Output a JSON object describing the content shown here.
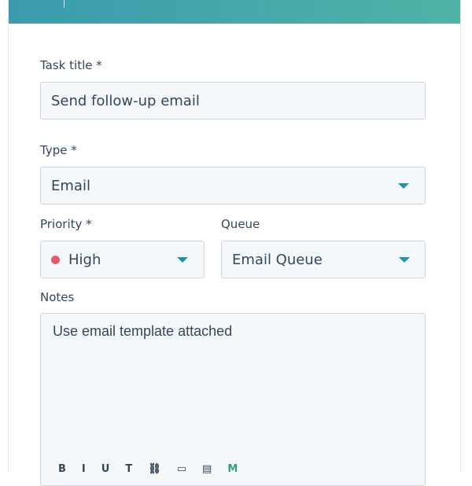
{
  "form": {
    "task_title": {
      "label": "Task title *",
      "value": "Send follow-up email"
    },
    "type": {
      "label": "Type *",
      "value": "Email"
    },
    "priority": {
      "label": "Priority *",
      "value": "High",
      "color": "#e35a6a"
    },
    "queue": {
      "label": "Queue",
      "value": "Email Queue"
    },
    "notes": {
      "label": "Notes",
      "value": "Use email template attached"
    }
  },
  "toolbar": {
    "items": [
      "B",
      "I",
      "U",
      "T",
      "link-icon",
      "image-icon",
      "document-icon",
      "M"
    ]
  },
  "colors": {
    "header_start": "#3a9cae",
    "header_end": "#4fb3a6",
    "caret": "#1f91ae",
    "field_background": "#f5f8fa",
    "field_border": "#cbd6e2"
  }
}
